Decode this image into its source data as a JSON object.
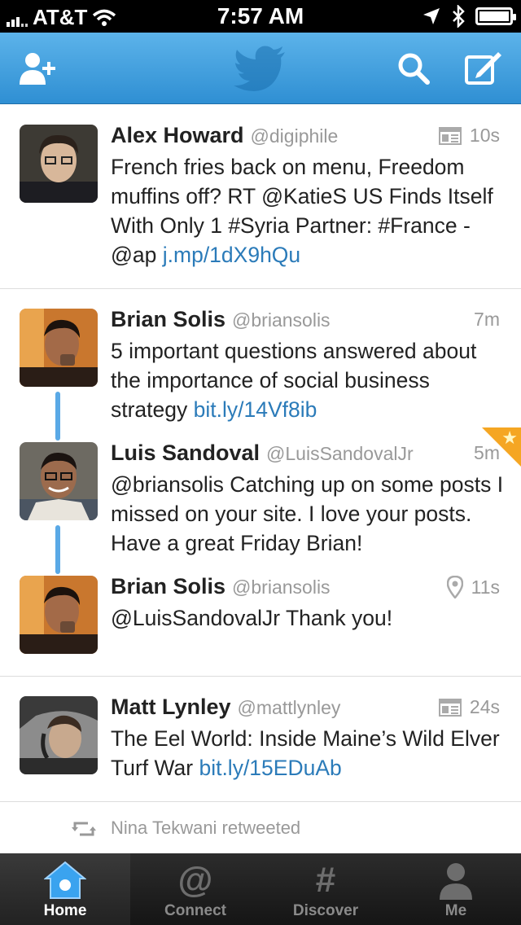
{
  "status_bar": {
    "carrier": "AT&T",
    "time": "7:57 AM"
  },
  "nav": {
    "add_user_icon": "add-user-icon",
    "logo_icon": "twitter-bird-icon",
    "search_icon": "search-icon",
    "compose_icon": "compose-icon"
  },
  "tweets": [
    {
      "name": "Alex Howard",
      "handle": "@digiphile",
      "time": "10s",
      "meta_icon": "summary-card-icon",
      "text": "French fries back on menu, Freedom muffins off? RT @KatieS US Finds Itself With Only 1 #Syria Partner: #France - @ap ",
      "link": "j.mp/1dX9hQu"
    },
    {
      "name": "Brian Solis",
      "handle": "@briansolis",
      "time": "7m",
      "text": "5 important questions answered about the importance of social business strategy ",
      "link": "bit.ly/14Vf8ib"
    },
    {
      "name": "Luis Sandoval",
      "handle": "@LuisSandovalJr",
      "time": "5m",
      "meta_icon": "favorite-star-icon",
      "text": "@briansolis Catching up on some posts I missed on your site. I love your posts. Have a great Friday Brian!"
    },
    {
      "name": "Brian Solis",
      "handle": "@briansolis",
      "time": "11s",
      "meta_icon": "location-pin-icon",
      "text": "@LuisSandovalJr Thank you!"
    },
    {
      "name": "Matt Lynley",
      "handle": "@mattlynley",
      "time": "24s",
      "meta_icon": "summary-card-icon",
      "text": "The Eel World: Inside Maine’s Wild Elver Turf War ",
      "link": "bit.ly/15EDuAb"
    }
  ],
  "retweet_notice": {
    "icon": "retweet-icon",
    "text": "Nina Tekwani retweeted"
  },
  "tabs": [
    {
      "label": "Home",
      "icon": "home-icon",
      "active": true
    },
    {
      "label": "Connect",
      "icon": "at-icon",
      "active": false
    },
    {
      "label": "Discover",
      "icon": "hashtag-icon",
      "active": false
    },
    {
      "label": "Me",
      "icon": "person-icon",
      "active": false
    }
  ],
  "colors": {
    "nav_blue": "#2f8fd3",
    "link_blue": "#2b7bb9",
    "thread_blue": "#5aa9e6",
    "favorite_orange": "#f5a623"
  }
}
